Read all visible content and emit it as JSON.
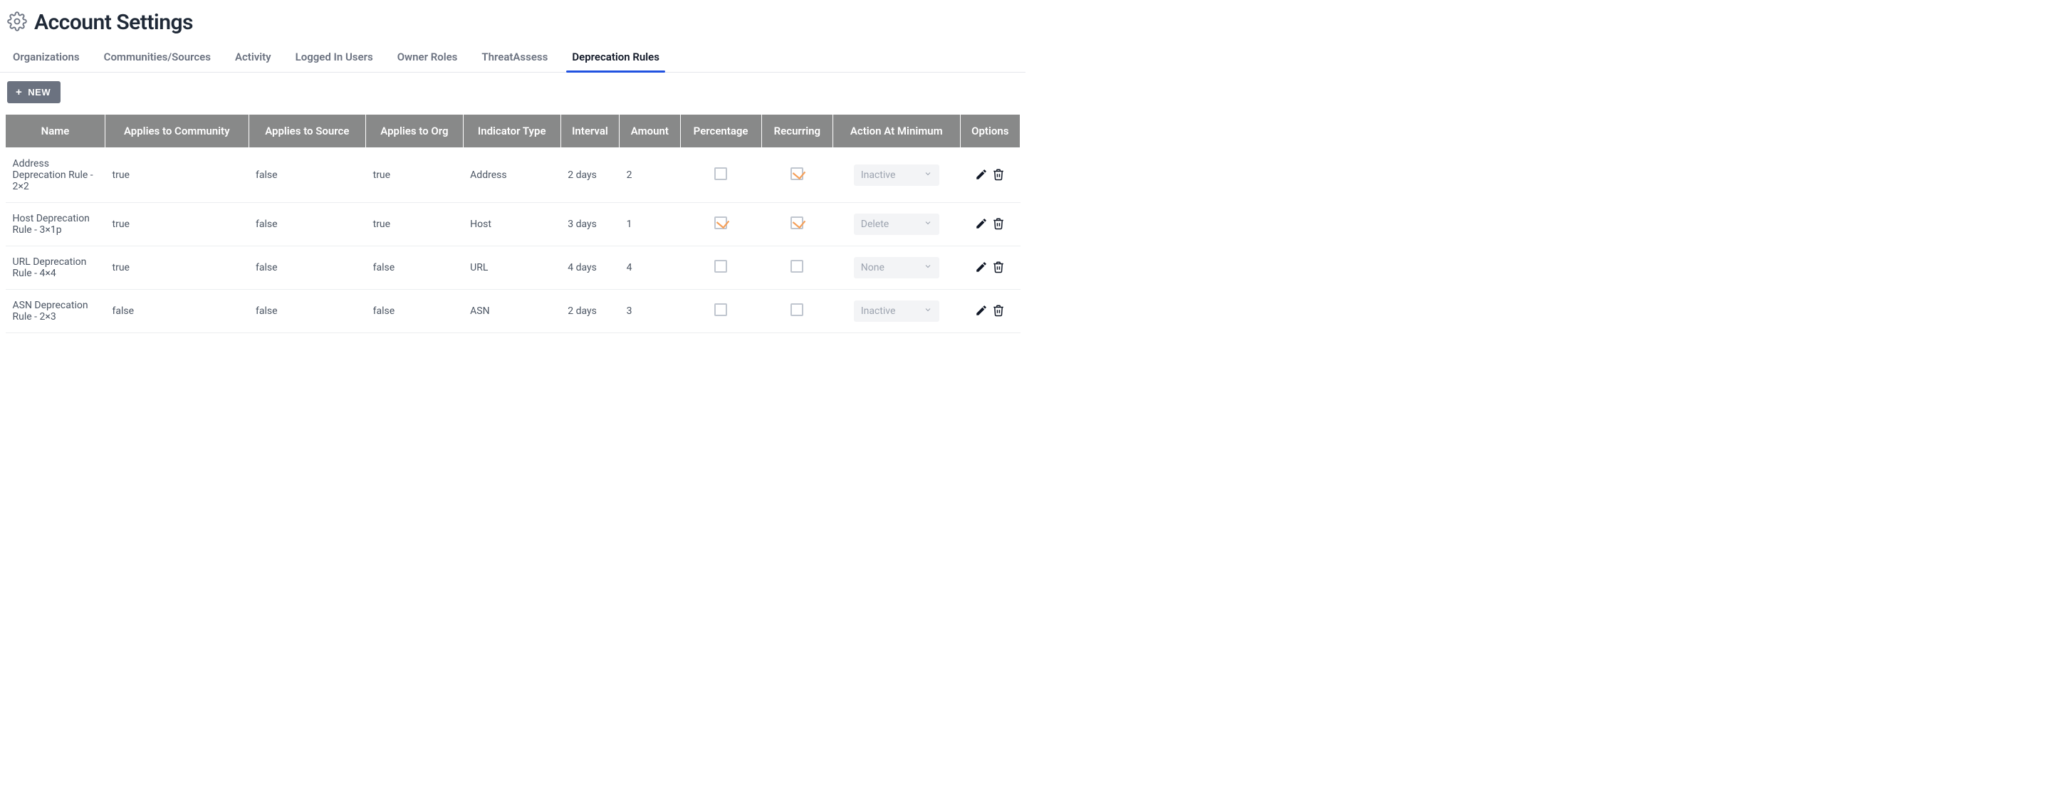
{
  "page": {
    "title": "Account Settings"
  },
  "tabs": [
    {
      "label": "Organizations",
      "active": false
    },
    {
      "label": "Communities/Sources",
      "active": false
    },
    {
      "label": "Activity",
      "active": false
    },
    {
      "label": "Logged In Users",
      "active": false
    },
    {
      "label": "Owner Roles",
      "active": false
    },
    {
      "label": "ThreatAssess",
      "active": false
    },
    {
      "label": "Deprecation Rules",
      "active": true
    }
  ],
  "toolbar": {
    "new_label": "NEW"
  },
  "table": {
    "columns": [
      "Name",
      "Applies to Community",
      "Applies to Source",
      "Applies to Org",
      "Indicator Type",
      "Interval",
      "Amount",
      "Percentage",
      "Recurring",
      "Action At Minimum",
      "Options"
    ],
    "rows": [
      {
        "name": "Address Deprecation Rule - 2×2",
        "community": "true",
        "source": "false",
        "org": "true",
        "indicator": "Address",
        "interval": "2 days",
        "amount": "2",
        "percentage": false,
        "recurring": true,
        "action": "Inactive"
      },
      {
        "name": "Host Deprecation Rule - 3×1p",
        "community": "true",
        "source": "false",
        "org": "true",
        "indicator": "Host",
        "interval": "3 days",
        "amount": "1",
        "percentage": true,
        "recurring": true,
        "action": "Delete"
      },
      {
        "name": "URL Deprecation Rule - 4×4",
        "community": "true",
        "source": "false",
        "org": "false",
        "indicator": "URL",
        "interval": "4 days",
        "amount": "4",
        "percentage": false,
        "recurring": false,
        "action": "None"
      },
      {
        "name": "ASN Deprecation Rule - 2×3",
        "community": "false",
        "source": "false",
        "org": "false",
        "indicator": "ASN",
        "interval": "2 days",
        "amount": "3",
        "percentage": false,
        "recurring": false,
        "action": "Inactive"
      }
    ]
  }
}
